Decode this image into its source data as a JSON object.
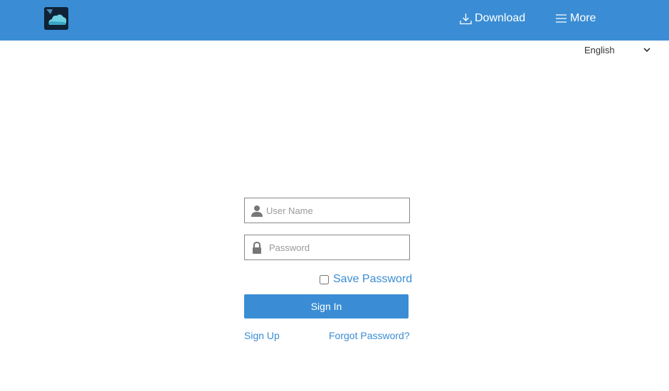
{
  "header": {
    "logo_icon": "cloud-app-logo",
    "download_label": "Download",
    "download_icon": "download-icon",
    "more_label": "More",
    "more_icon": "menu-icon",
    "background_color": "#3a8dd4"
  },
  "language": {
    "selected": "English",
    "options": [
      "English"
    ]
  },
  "login": {
    "username_placeholder": "User Name",
    "username_value": "",
    "password_placeholder": "Password",
    "password_value": "",
    "save_password_label": "Save Password",
    "save_password_checked": false,
    "signin_label": "Sign In",
    "signup_label": "Sign Up",
    "forgot_label": "Forgot Password?",
    "accent_color": "#3a8dd4"
  }
}
